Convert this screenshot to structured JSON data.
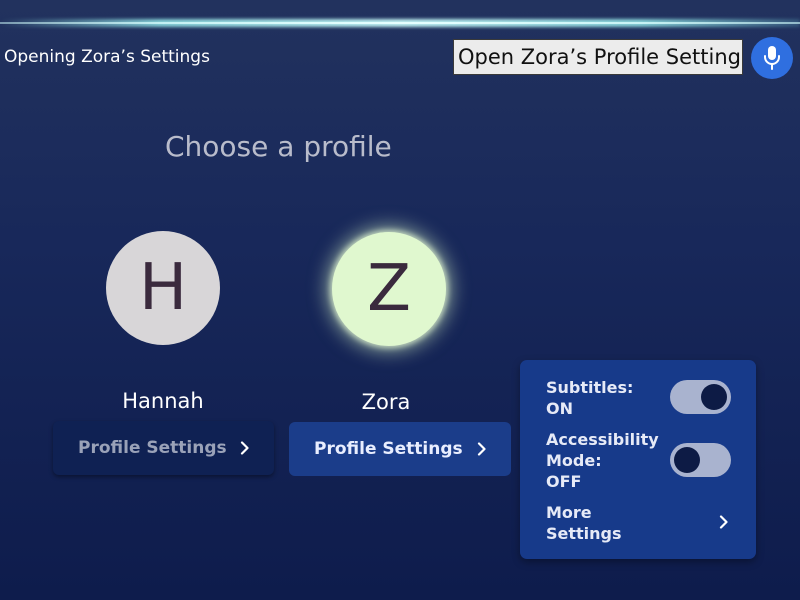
{
  "status": {
    "text": "Opening Zora’s Settings"
  },
  "voice": {
    "query": "Open Zora’s Profile Settings",
    "mic_icon": "microphone-icon",
    "mic_color": "#2f6fe0"
  },
  "page": {
    "title": "Choose a profile"
  },
  "profiles": [
    {
      "initial": "H",
      "name": "Hannah",
      "settings_label": "Profile Settings",
      "avatar_color": "#d8d6d8",
      "selected": false
    },
    {
      "initial": "Z",
      "name": "Zora",
      "settings_label": "Profile Settings",
      "avatar_color": "#e0f8cf",
      "selected": true
    }
  ],
  "settings_popup": {
    "subtitles": {
      "label_line1": "Subtitles:",
      "label_line2": "ON",
      "state": "on"
    },
    "accessibility": {
      "label_line1": "Accessibility",
      "label_line2": "Mode:",
      "label_line3": "OFF",
      "state": "off"
    },
    "more": {
      "label_line1": "More",
      "label_line2": "Settings",
      "icon": "chevron-right-icon"
    }
  },
  "colors": {
    "background": "#18285a",
    "popup": "#173a8a",
    "button_active": "#1b3d8a",
    "button_inactive": "#0f2153"
  }
}
